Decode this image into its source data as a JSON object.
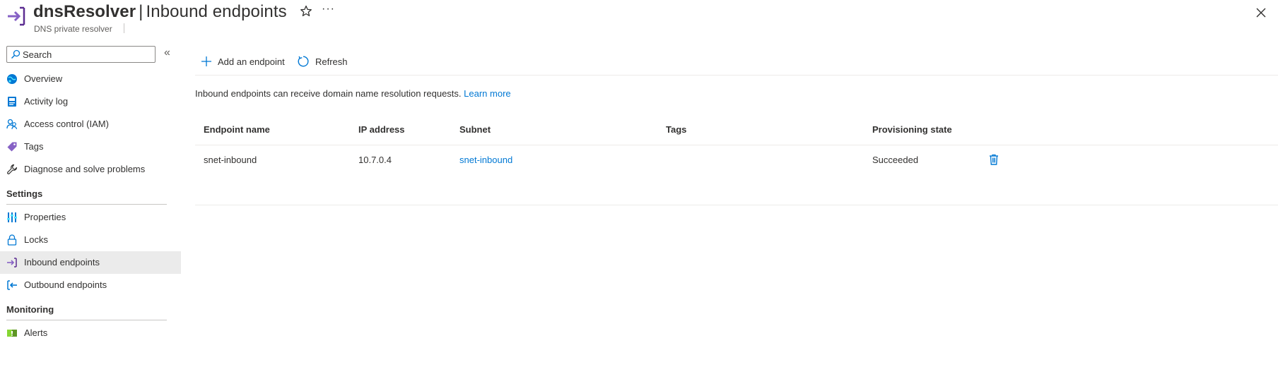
{
  "header": {
    "resource_name": "dnsResolver",
    "separator": "|",
    "page_title": "Inbound endpoints",
    "subtitle": "DNS private resolver",
    "more_label": "···"
  },
  "sidebar": {
    "search_placeholder": "Search",
    "collapse_label": "«",
    "items": [
      {
        "label": "Overview",
        "icon": "globe-icon"
      },
      {
        "label": "Activity log",
        "icon": "activity-log-icon"
      },
      {
        "label": "Access control (IAM)",
        "icon": "people-icon"
      },
      {
        "label": "Tags",
        "icon": "tag-icon"
      },
      {
        "label": "Diagnose and solve problems",
        "icon": "wrench-icon"
      }
    ],
    "settings_heading": "Settings",
    "settings_items": [
      {
        "label": "Properties",
        "icon": "properties-icon"
      },
      {
        "label": "Locks",
        "icon": "lock-icon"
      },
      {
        "label": "Inbound endpoints",
        "icon": "inbound-endpoint-icon"
      },
      {
        "label": "Outbound endpoints",
        "icon": "outbound-endpoint-icon"
      }
    ],
    "monitoring_heading": "Monitoring",
    "monitoring_items": [
      {
        "label": "Alerts",
        "icon": "alerts-icon"
      }
    ]
  },
  "toolbar": {
    "add_label": "Add an endpoint",
    "refresh_label": "Refresh"
  },
  "info": {
    "text": "Inbound endpoints can receive domain name resolution requests.",
    "link": "Learn more"
  },
  "table": {
    "columns": [
      "Endpoint name",
      "IP address",
      "Subnet",
      "Tags",
      "Provisioning state"
    ],
    "rows": [
      {
        "endpoint_name": "snet-inbound",
        "ip_address": "10.7.0.4",
        "subnet": "snet-inbound",
        "tags": "",
        "provisioning_state": "Succeeded"
      }
    ]
  },
  "colors": {
    "accent": "#0078d4",
    "resource_icon": "#8661c5",
    "active_nav_bg": "#ebebeb"
  }
}
